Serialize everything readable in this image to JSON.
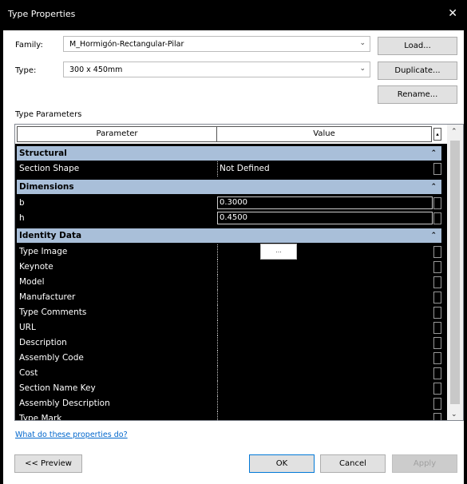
{
  "window": {
    "title": "Type Properties",
    "close_glyph": "✕"
  },
  "family": {
    "label": "Family:",
    "value": "M_Hormigón-Rectangular-Pilar",
    "load_label": "Load..."
  },
  "type": {
    "label": "Type:",
    "value": "300 x 450mm",
    "duplicate_label": "Duplicate...",
    "rename_label": "Rename..."
  },
  "type_parameters": {
    "label": "Type Parameters"
  },
  "grid": {
    "header_parameter": "Parameter",
    "header_value": "Value",
    "groups": [
      {
        "label": "Structural"
      },
      {
        "label": "Dimensions"
      },
      {
        "label": "Identity Data"
      }
    ],
    "rows": {
      "section_shape": {
        "name": "Section Shape",
        "value": "Not Defined"
      },
      "b": {
        "name": "b",
        "value": "0.3000"
      },
      "h": {
        "name": "h",
        "value": "0.4500"
      },
      "type_image": {
        "name": "Type Image",
        "value": ""
      },
      "keynote": {
        "name": "Keynote",
        "value": ""
      },
      "model": {
        "name": "Model",
        "value": ""
      },
      "manufacturer": {
        "name": "Manufacturer",
        "value": ""
      },
      "type_comments": {
        "name": "Type Comments",
        "value": ""
      },
      "url": {
        "name": "URL",
        "value": ""
      },
      "description": {
        "name": "Description",
        "value": ""
      },
      "assembly_code": {
        "name": "Assembly Code",
        "value": ""
      },
      "cost": {
        "name": "Cost",
        "value": ""
      },
      "section_name_key": {
        "name": "Section Name Key",
        "value": ""
      },
      "assembly_description": {
        "name": "Assembly Description",
        "value": ""
      },
      "type_mark": {
        "name": "Type Mark",
        "value": ""
      }
    },
    "tooltip": "..."
  },
  "help_link": "What do these properties do?",
  "footer": {
    "preview_label": "<< Preview",
    "ok_label": "OK",
    "cancel_label": "Cancel",
    "apply_label": "Apply"
  },
  "icons": {
    "dropdown": "chevron-down-icon",
    "collapse": "double-chevron-up-icon",
    "close": "close-icon"
  }
}
